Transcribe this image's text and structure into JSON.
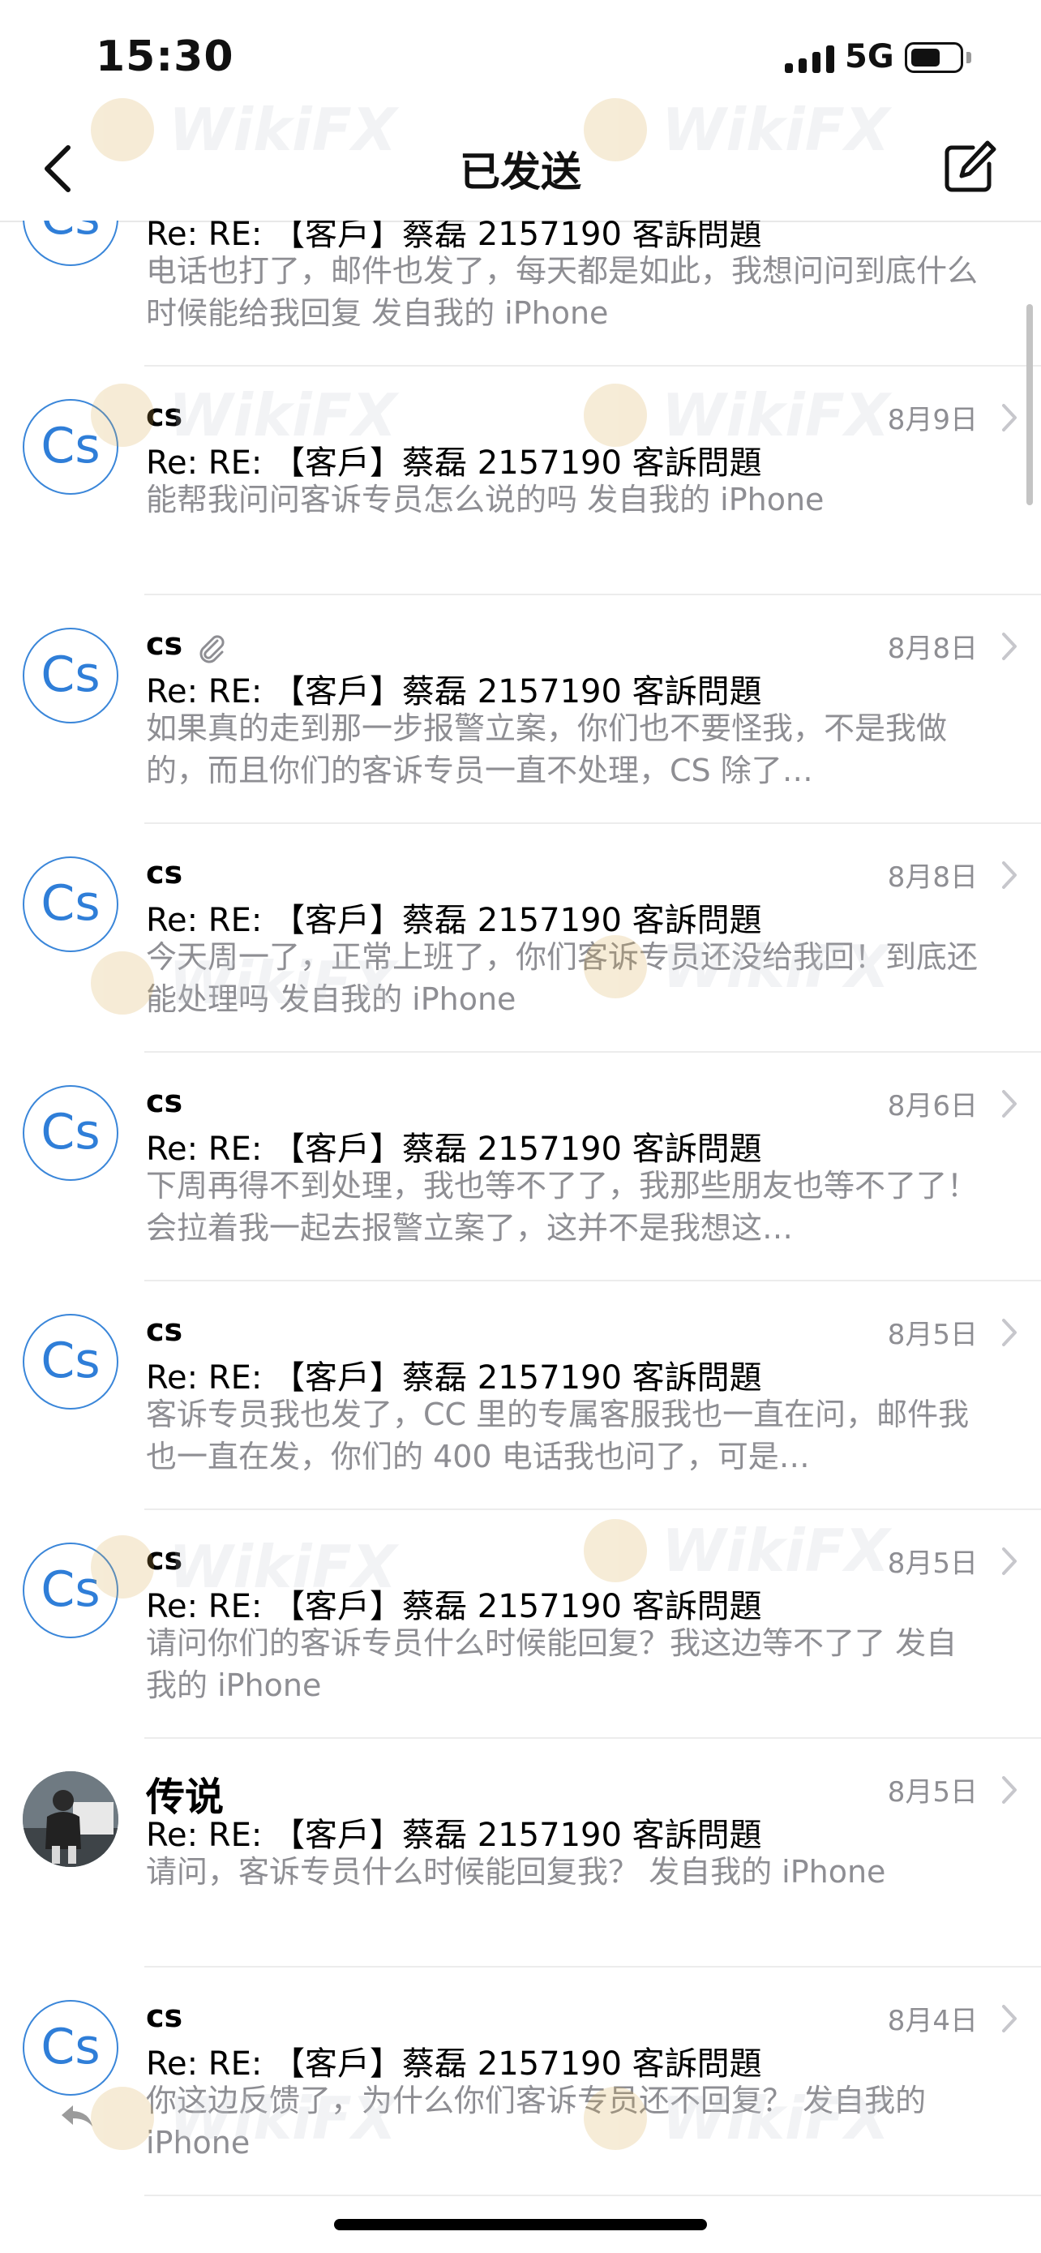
{
  "status": {
    "time": "15:30",
    "network": "5G"
  },
  "nav": {
    "title": "已发送"
  },
  "watermark": "WikiFX",
  "emails": [
    {
      "sender": "",
      "avatar": "Cs",
      "date": "",
      "subject": "Re: RE: 【客戶】蔡磊 2157190 客訴問題",
      "preview": "电话也打了，邮件也发了，每天都是如此，我想问问到底什么时候能给我回复  发自我的 iPhone"
    },
    {
      "sender": "cs",
      "avatar": "Cs",
      "date": "8月9日",
      "subject": "Re: RE: 【客戶】蔡磊 2157190 客訴問題",
      "preview": "能帮我问问客诉专员怎么说的吗  发自我的 iPhone"
    },
    {
      "sender": "cs",
      "avatar": "Cs",
      "date": "8月8日",
      "subject": "Re: RE: 【客戶】蔡磊 2157190 客訴問題",
      "preview": "如果真的走到那一步报警立案，你们也不要怪我，不是我做的，而且你们的客诉专员一直不处理，CS 除了…"
    },
    {
      "sender": "cs",
      "avatar": "Cs",
      "date": "8月8日",
      "subject": "Re: RE: 【客戶】蔡磊 2157190 客訴問題",
      "preview": "今天周一了，正常上班了，你们客诉专员还没给我回！到底还能处理吗  发自我的 iPhone"
    },
    {
      "sender": "cs",
      "avatar": "Cs",
      "date": "8月6日",
      "subject": "Re: RE: 【客戶】蔡磊 2157190 客訴問題",
      "preview": "下周再得不到处理，我也等不了了，我那些朋友也等不了了！会拉着我一起去报警立案了，这并不是我想这…"
    },
    {
      "sender": "cs",
      "avatar": "Cs",
      "date": "8月5日",
      "subject": "Re: RE: 【客戶】蔡磊 2157190 客訴問題",
      "preview": "客诉专员我也发了，CC 里的专属客服我也一直在问，邮件我也一直在发，你们的 400 电话我也问了，可是…"
    },
    {
      "sender": "cs",
      "avatar": "Cs",
      "date": "8月5日",
      "subject": "Re: RE: 【客戶】蔡磊 2157190 客訴問題",
      "preview": "请问你们的客诉专员什么时候能回复？我这边等不了了  发自我的 iPhone"
    },
    {
      "sender": "传说",
      "avatar": "",
      "date": "8月5日",
      "subject": "Re: RE: 【客戶】蔡磊 2157190 客訴問題",
      "preview": "请问，客诉专员什么时候能回复我？   发自我的 iPhone"
    },
    {
      "sender": "cs",
      "avatar": "Cs",
      "date": "8月4日",
      "subject": "Re: RE: 【客戶】蔡磊 2157190 客訴問題",
      "preview": "你这边反馈了，为什么你们客诉专员还不回复？  发自我的 iPhone"
    }
  ]
}
